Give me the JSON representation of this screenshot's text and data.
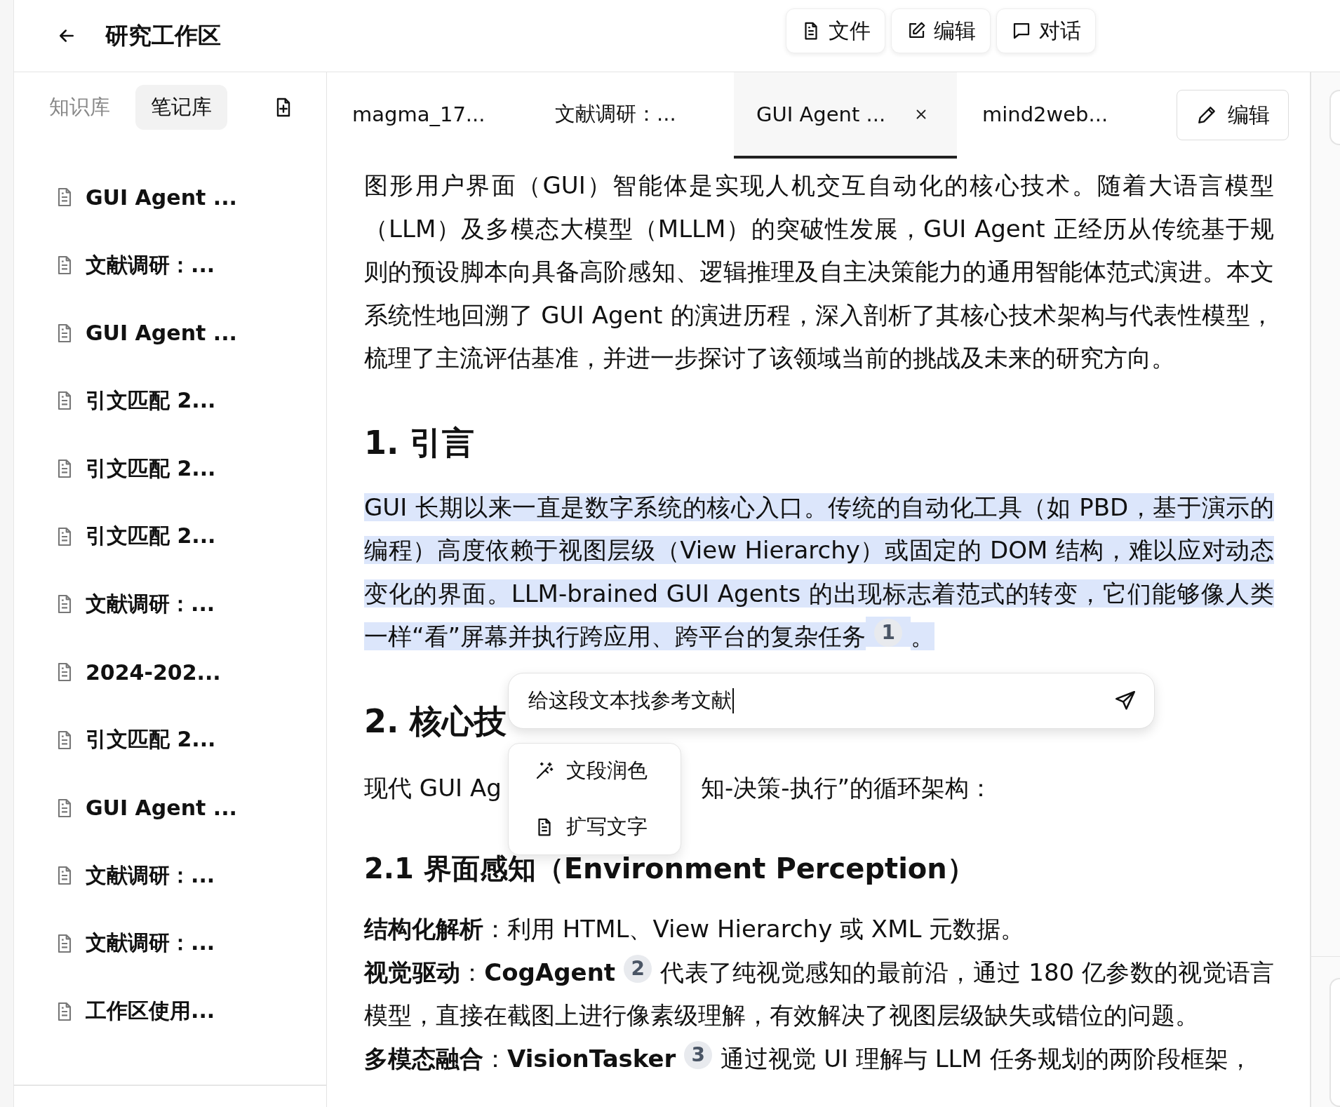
{
  "header": {
    "title": "研究工作区",
    "buttons": [
      {
        "label": "文件"
      },
      {
        "label": "编辑"
      },
      {
        "label": "对话"
      }
    ]
  },
  "sidebar": {
    "tabs": [
      {
        "label": "知识库",
        "selected": false
      },
      {
        "label": "笔记库",
        "selected": true
      }
    ],
    "items": [
      {
        "label": "GUI Agent ..."
      },
      {
        "label": "文献调研：..."
      },
      {
        "label": "GUI Agent ..."
      },
      {
        "label": "引文匹配 2..."
      },
      {
        "label": "引文匹配 2..."
      },
      {
        "label": "引文匹配 2..."
      },
      {
        "label": "文献调研：..."
      },
      {
        "label": "2024-202..."
      },
      {
        "label": "引文匹配 2..."
      },
      {
        "label": "GUI Agent ..."
      },
      {
        "label": "文献调研：..."
      },
      {
        "label": "文献调研：..."
      },
      {
        "label": "工作区使用..."
      }
    ]
  },
  "editor": {
    "tabs": [
      {
        "label": "magma_17...",
        "selected": false
      },
      {
        "label": "文献调研：...",
        "selected": false
      },
      {
        "label": "GUI Agent ...",
        "selected": true
      },
      {
        "label": "mind2web...",
        "selected": false
      }
    ],
    "edit_button": "编辑",
    "blocks": [
      {
        "kind": "paragraph",
        "highlighted": false,
        "segments": [
          {
            "kind": "text",
            "text": "图形用户界面（GUI）智能体是实现人机交互自动化的核心技术。随着大语言模型（LLM）及多模态大模型（MLLM）的突破性发展，GUI Agent 正经历从传统基于规则的预设脚本向具备高阶感知、逻辑推理及自主决策能力的通用智能体范式演进。本文系统性地回溯了 GUI Agent 的演进历程，深入剖析了其核心技术架构与代表性模型，梳理了主流评估基准，并进一步探讨了该领域当前的挑战及未来的研究方向。"
          }
        ]
      },
      {
        "kind": "heading1",
        "text": "1. 引言"
      },
      {
        "kind": "paragraph",
        "highlighted": true,
        "segments": [
          {
            "kind": "text",
            "text": "GUI 长期以来一直是数字系统的核心入口。传统的自动化工具（如 PBD，基于演示的编程）高度依赖于视图层级（View Hierarchy）或固定的 DOM 结构，难以应对动态变化的界面。LLM-brained GUI Agents 的出现标志着范式的转变，它们能够像人类一样“看”屏幕并执行跨应用、跨平台的复杂任务"
          },
          {
            "kind": "cite",
            "text": "1"
          },
          {
            "kind": "text",
            "text": "。"
          }
        ]
      },
      {
        "kind": "heading1",
        "text": "2. 核心技"
      },
      {
        "kind": "split",
        "parts": [
          "现代 GUI Ag",
          "知-决策-执行”的循环架构："
        ]
      },
      {
        "kind": "heading2",
        "text": "2.1 界面感知（Environment Perception）"
      },
      {
        "kind": "paragraph",
        "highlighted": false,
        "segments": [
          {
            "kind": "text",
            "text": "**结构化解析**：利用 HTML、View Hierarchy 或 XML 元数据。"
          }
        ]
      },
      {
        "kind": "paragraph",
        "highlighted": false,
        "segments": [
          {
            "kind": "text",
            "text": "**视觉驱动**：**CogAgent**"
          },
          {
            "kind": "cite",
            "text": "2"
          },
          {
            "kind": "text",
            "text": "代表了纯视觉感知的最前沿，通过 180 亿参数的视觉语言模型，直接在截图上进行像素级理解，有效解决了视图层级缺失或错位的问题。"
          }
        ]
      },
      {
        "kind": "paragraph",
        "highlighted": false,
        "segments": [
          {
            "kind": "text",
            "text": "**多模态融合**：**VisionTasker**"
          },
          {
            "kind": "cite",
            "text": "3"
          },
          {
            "kind": "text",
            "text": "通过视觉 UI 理解与 LLM 任务规划的两阶段框架，"
          }
        ]
      }
    ],
    "prompt": {
      "value": "给这段文本找参考文献"
    },
    "menu": [
      {
        "label": "文段润色"
      },
      {
        "label": "扩写文字"
      }
    ]
  }
}
